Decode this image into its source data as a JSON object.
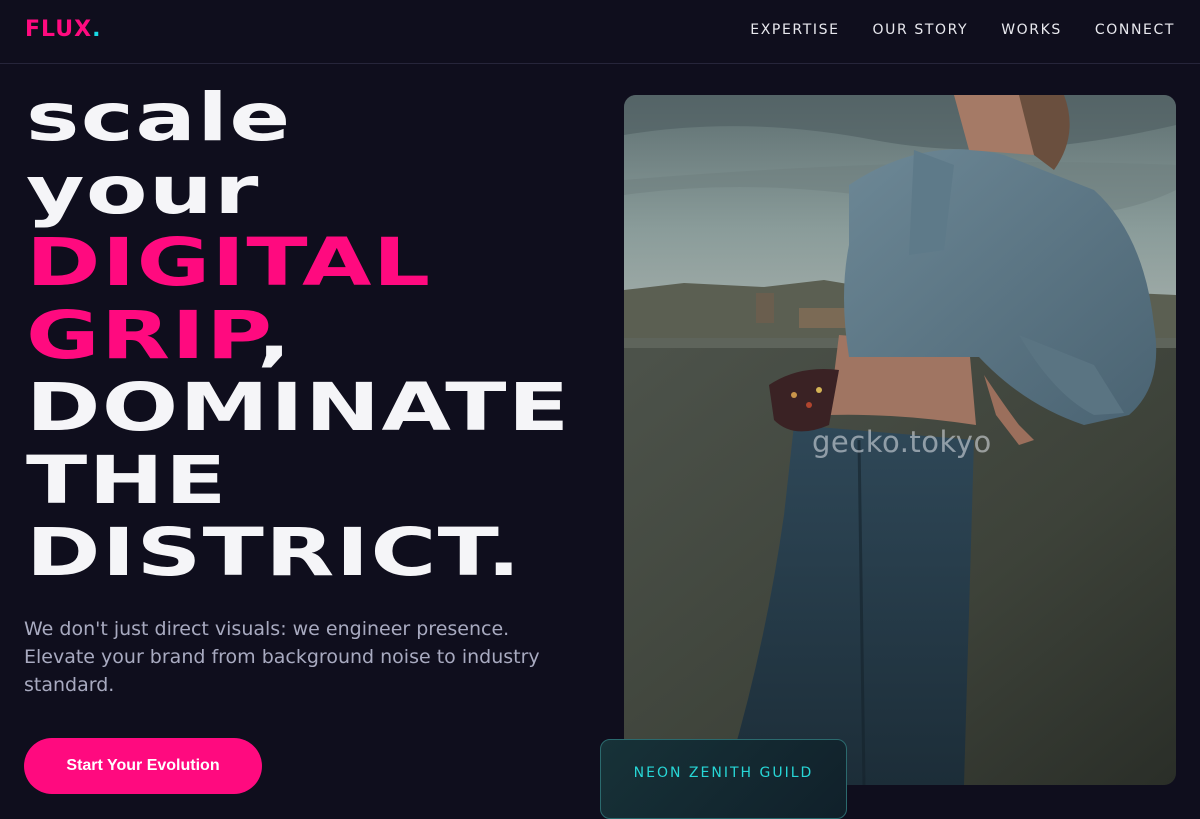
{
  "brand": {
    "name": "FLUX",
    "dot": ".",
    "accent": "#ff0a7f",
    "dot_color": "#17d9e4"
  },
  "nav": {
    "items": [
      "EXPERTISE",
      "OUR STORY",
      "WORKS",
      "CONNECT"
    ]
  },
  "hero": {
    "headline": {
      "line1": "scale",
      "line2": "your",
      "line3": "DIGITAL",
      "line4_pink": "GRIP",
      "line4_comma": ",",
      "line5": "DOMINATE",
      "line6": "THE",
      "line7": "DISTRICT."
    },
    "subtext": "We don't just direct visuals: we engineer presence. Elevate your brand from background noise to industry standard.",
    "cta_label": "Start Your Evolution"
  },
  "photo": {
    "watermark": "gecko.tokyo",
    "icon": "hero-photo-image"
  },
  "badge": {
    "label": "NEON ZENITH GUILD"
  },
  "colors": {
    "background": "#0f0e1d",
    "accent": "#ff0a7f",
    "badge_text": "#27d6d6"
  }
}
